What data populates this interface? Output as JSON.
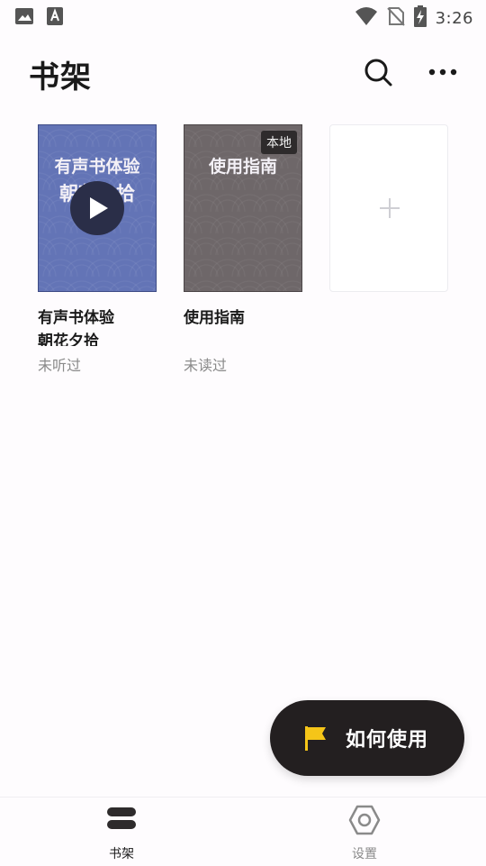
{
  "status_bar": {
    "time": "3:26",
    "left_icons": [
      "image-icon",
      "text-a-icon"
    ],
    "right_icons": [
      "wifi-icon",
      "no-sim-icon",
      "battery-charging-icon"
    ]
  },
  "header": {
    "title": "书架",
    "search_icon": "search-icon",
    "more_icon": "more-icon"
  },
  "books": [
    {
      "cover_title": "有声书体验",
      "cover_subtitle": "朝花夕拾",
      "cover_color": "#6374b6",
      "title_line1": "有声书体验",
      "title_line2": "朝花夕拾",
      "status": "未听过"
    },
    {
      "cover_title": "使用指南",
      "badge": "本地",
      "cover_color": "#6e6769",
      "title_line1": "使用指南",
      "status": "未读过"
    }
  ],
  "fab": {
    "label": "如何使用",
    "flag_color": "#f5c518",
    "background": "#231f20"
  },
  "bottom_nav": [
    {
      "label": "书架",
      "icon": "bookshelf-icon",
      "active": true
    },
    {
      "label": "设置",
      "icon": "settings-icon",
      "active": false
    }
  ]
}
